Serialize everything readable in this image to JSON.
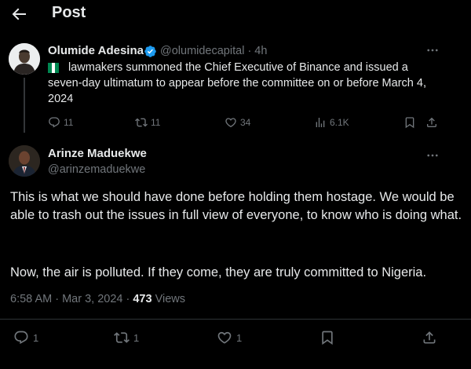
{
  "header": {
    "title": "Post"
  },
  "parent": {
    "name": "Olumide Adesina",
    "meta": "@olumidecapital · 4h",
    "text": "lawmakers summoned the Chief Executive of Binance and issued a seven-day ultimatum to appear before the committee on or before March 4, 2024",
    "replies": "11",
    "reposts": "11",
    "likes": "34",
    "views": "6.1K"
  },
  "main": {
    "name": "Arinze Maduekwe",
    "handle": "@arinzemaduekwe",
    "paragraph1": "This is what we should have done before holding them hostage. We would be able to trash out the issues in full view of everyone, to know who is doing what.",
    "paragraph2": "Now, the air is polluted. If they come, they are truly committed to Nigeria.",
    "time": "6:58 AM · Mar 3, 2024 · ",
    "views_count": "473",
    "views_label": " Views",
    "replies": "1",
    "reposts": "1",
    "likes": "1"
  },
  "colors": {
    "background": "#000000",
    "text": "#e7e9ea",
    "muted": "#71767b",
    "verified": "#1d9bf0",
    "flag_green": "#008751"
  }
}
